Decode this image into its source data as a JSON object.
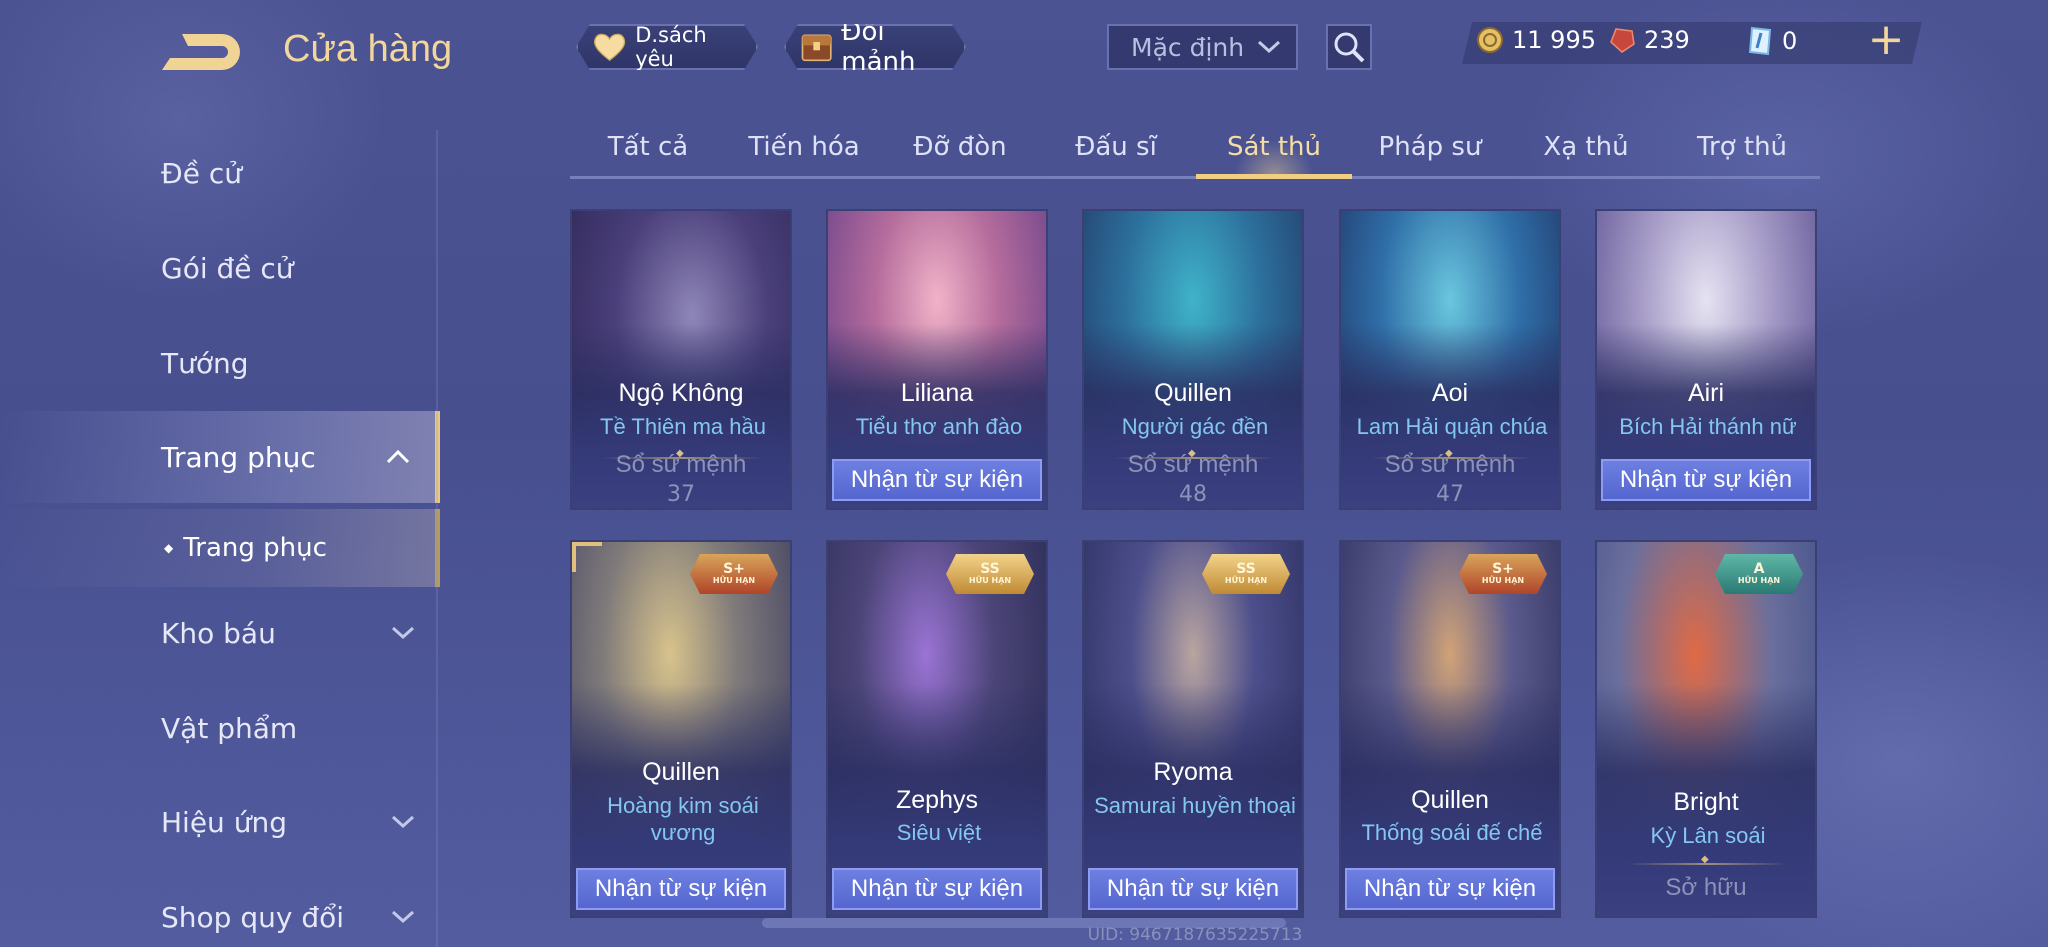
{
  "header": {
    "title": "Cửa hàng",
    "back_icon": "back-arrow-icon",
    "wishlist_label": "D.sách yêu",
    "shard_exchange_label": "Đổi mảnh",
    "sort": {
      "selected": "Mặc định"
    },
    "add_label": "+"
  },
  "currency": {
    "gold": "11 995",
    "rubies": "239",
    "vouchers": "0"
  },
  "sidebar": {
    "items": [
      {
        "label": "Đề cử",
        "chevron": ""
      },
      {
        "label": "Gói đề cử",
        "chevron": ""
      },
      {
        "label": "Tướng",
        "chevron": ""
      },
      {
        "label": "Trang phục",
        "chevron": "up"
      },
      {
        "label": "Kho báu",
        "chevron": "down"
      },
      {
        "label": "Vật phẩm",
        "chevron": ""
      },
      {
        "label": "Hiệu ứng",
        "chevron": "down"
      },
      {
        "label": "Shop quy đổi",
        "chevron": "down"
      }
    ],
    "sub_item": {
      "bullet": "◆",
      "label": "Trang phục"
    },
    "active_index": 3
  },
  "tabs": [
    {
      "label": "Tất cả"
    },
    {
      "label": "Tiến hóa"
    },
    {
      "label": "Đỡ đòn"
    },
    {
      "label": "Đấu sĩ"
    },
    {
      "label": "Sát thủ",
      "active": true
    },
    {
      "label": "Pháp sư"
    },
    {
      "label": "Xạ thủ"
    },
    {
      "label": "Trợ thủ"
    }
  ],
  "cards": [
    {
      "hero": "Ngộ Không",
      "skin": "Tề Thiên ma hầu",
      "action": "status",
      "status": "Sổ sứ mệnh",
      "price": "37"
    },
    {
      "hero": "Liliana",
      "skin": "Tiểu thơ anh đào",
      "action": "button",
      "button": "Nhận từ sự kiện"
    },
    {
      "hero": "Quillen",
      "skin": "Người gác đền",
      "action": "status",
      "status": "Sổ sứ mệnh",
      "price": "48"
    },
    {
      "hero": "Aoi",
      "skin": "Lam Hải quận chúa",
      "action": "status",
      "status": "Sổ sứ mệnh",
      "price": "47"
    },
    {
      "hero": "Airi",
      "skin": "Bích Hải thánh nữ",
      "action": "button",
      "button": "Nhận từ sự kiện"
    },
    {
      "hero": "Quillen",
      "skin": "Hoàng kim soái vương",
      "action": "button",
      "button": "Nhận từ sự kiện",
      "tier": "S+",
      "tier_note": "HỮU HẠN"
    },
    {
      "hero": "Zephys",
      "skin": "Siêu việt",
      "action": "button",
      "button": "Nhận từ sự kiện",
      "tier": "SS",
      "tier_note": "HỮU HẠN"
    },
    {
      "hero": "Ryoma",
      "skin": "Samurai huyền thoại",
      "action": "button",
      "button": "Nhận từ sự kiện",
      "tier": "SS",
      "tier_note": "HỮU HẠN"
    },
    {
      "hero": "Quillen",
      "skin": "Thống soái đế chế",
      "action": "button",
      "button": "Nhận từ sự kiện",
      "tier": "S+",
      "tier_note": "HỮU HẠN"
    },
    {
      "hero": "Bright",
      "skin": "Kỳ Lân soái",
      "action": "status",
      "status": "Sở hữu",
      "tier": "A",
      "tier_note": "HỮU HẠN"
    }
  ],
  "footer": {
    "uid": "UID: 9467187635225713"
  },
  "colors": {
    "background": "#4b5393",
    "accent_gold": "#f2d69a",
    "button_blue": "#5b6dd6",
    "skin_name_blue": "#83c7f0"
  }
}
